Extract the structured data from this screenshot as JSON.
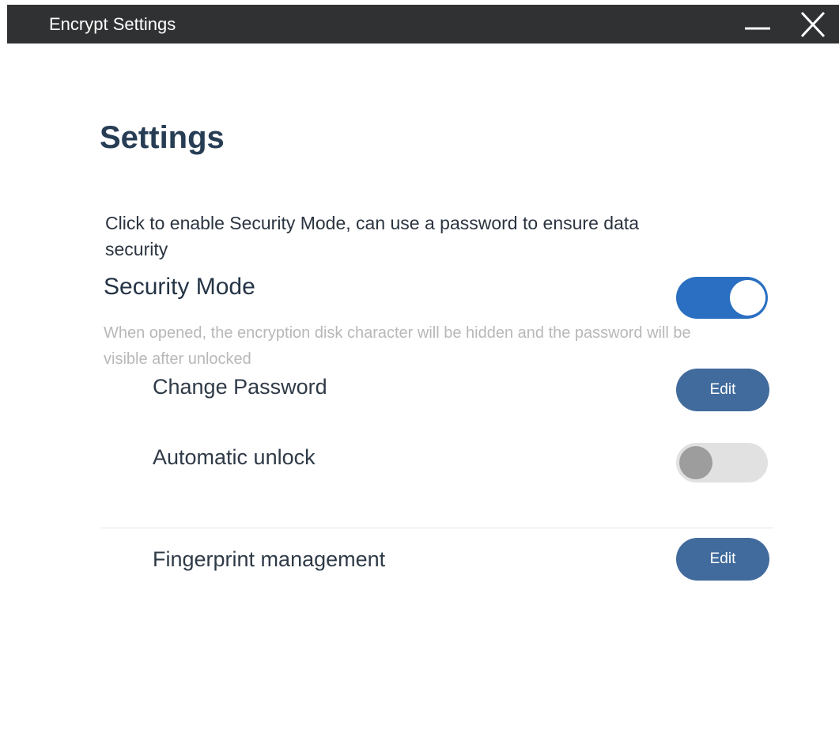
{
  "window": {
    "title": "Encrypt Settings"
  },
  "page": {
    "title": "Settings",
    "intro": "Click to enable  Security Mode, can use a password to ensure data security"
  },
  "security_mode": {
    "label": "Security Mode",
    "enabled": true,
    "description": "When opened, the encryption disk character will be hidden and the password will be visible after unlocked"
  },
  "change_password": {
    "label": "Change Password",
    "button_label": "Edit"
  },
  "automatic_unlock": {
    "label": "Automatic unlock",
    "enabled": false
  },
  "fingerprint": {
    "label": "Fingerprint management",
    "button_label": "Edit"
  },
  "icons": {
    "minimize": "minimize-icon",
    "close": "close-icon"
  },
  "colors": {
    "titlebar": "#2f3132",
    "heading": "#263d54",
    "toggle_on": "#2a6fc1",
    "toggle_off": "#e1e1e1",
    "button": "#416b9c",
    "muted_text": "#b8b8b8"
  }
}
